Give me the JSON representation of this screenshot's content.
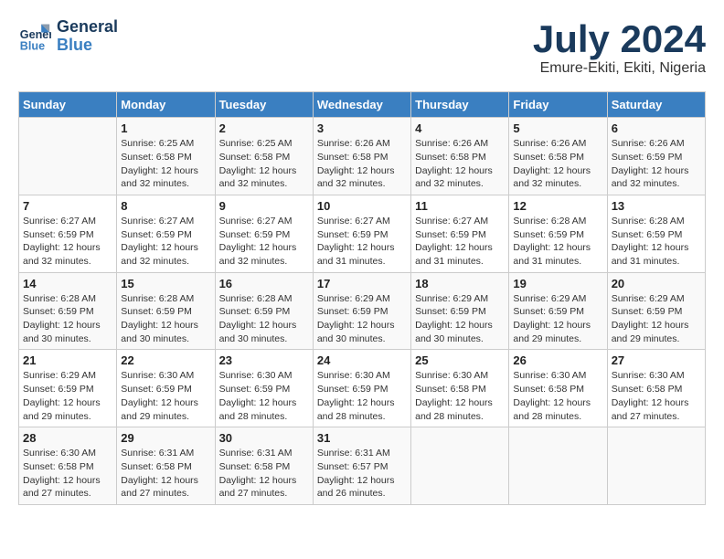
{
  "logo": {
    "line1": "General",
    "line2": "Blue"
  },
  "title": "July 2024",
  "subtitle": "Emure-Ekiti, Ekiti, Nigeria",
  "days_header": [
    "Sunday",
    "Monday",
    "Tuesday",
    "Wednesday",
    "Thursday",
    "Friday",
    "Saturday"
  ],
  "weeks": [
    [
      {
        "num": "",
        "sunrise": "",
        "sunset": "",
        "daylight": ""
      },
      {
        "num": "1",
        "sunrise": "Sunrise: 6:25 AM",
        "sunset": "Sunset: 6:58 PM",
        "daylight": "Daylight: 12 hours and 32 minutes."
      },
      {
        "num": "2",
        "sunrise": "Sunrise: 6:25 AM",
        "sunset": "Sunset: 6:58 PM",
        "daylight": "Daylight: 12 hours and 32 minutes."
      },
      {
        "num": "3",
        "sunrise": "Sunrise: 6:26 AM",
        "sunset": "Sunset: 6:58 PM",
        "daylight": "Daylight: 12 hours and 32 minutes."
      },
      {
        "num": "4",
        "sunrise": "Sunrise: 6:26 AM",
        "sunset": "Sunset: 6:58 PM",
        "daylight": "Daylight: 12 hours and 32 minutes."
      },
      {
        "num": "5",
        "sunrise": "Sunrise: 6:26 AM",
        "sunset": "Sunset: 6:58 PM",
        "daylight": "Daylight: 12 hours and 32 minutes."
      },
      {
        "num": "6",
        "sunrise": "Sunrise: 6:26 AM",
        "sunset": "Sunset: 6:59 PM",
        "daylight": "Daylight: 12 hours and 32 minutes."
      }
    ],
    [
      {
        "num": "7",
        "sunrise": "Sunrise: 6:27 AM",
        "sunset": "Sunset: 6:59 PM",
        "daylight": "Daylight: 12 hours and 32 minutes."
      },
      {
        "num": "8",
        "sunrise": "Sunrise: 6:27 AM",
        "sunset": "Sunset: 6:59 PM",
        "daylight": "Daylight: 12 hours and 32 minutes."
      },
      {
        "num": "9",
        "sunrise": "Sunrise: 6:27 AM",
        "sunset": "Sunset: 6:59 PM",
        "daylight": "Daylight: 12 hours and 32 minutes."
      },
      {
        "num": "10",
        "sunrise": "Sunrise: 6:27 AM",
        "sunset": "Sunset: 6:59 PM",
        "daylight": "Daylight: 12 hours and 31 minutes."
      },
      {
        "num": "11",
        "sunrise": "Sunrise: 6:27 AM",
        "sunset": "Sunset: 6:59 PM",
        "daylight": "Daylight: 12 hours and 31 minutes."
      },
      {
        "num": "12",
        "sunrise": "Sunrise: 6:28 AM",
        "sunset": "Sunset: 6:59 PM",
        "daylight": "Daylight: 12 hours and 31 minutes."
      },
      {
        "num": "13",
        "sunrise": "Sunrise: 6:28 AM",
        "sunset": "Sunset: 6:59 PM",
        "daylight": "Daylight: 12 hours and 31 minutes."
      }
    ],
    [
      {
        "num": "14",
        "sunrise": "Sunrise: 6:28 AM",
        "sunset": "Sunset: 6:59 PM",
        "daylight": "Daylight: 12 hours and 30 minutes."
      },
      {
        "num": "15",
        "sunrise": "Sunrise: 6:28 AM",
        "sunset": "Sunset: 6:59 PM",
        "daylight": "Daylight: 12 hours and 30 minutes."
      },
      {
        "num": "16",
        "sunrise": "Sunrise: 6:28 AM",
        "sunset": "Sunset: 6:59 PM",
        "daylight": "Daylight: 12 hours and 30 minutes."
      },
      {
        "num": "17",
        "sunrise": "Sunrise: 6:29 AM",
        "sunset": "Sunset: 6:59 PM",
        "daylight": "Daylight: 12 hours and 30 minutes."
      },
      {
        "num": "18",
        "sunrise": "Sunrise: 6:29 AM",
        "sunset": "Sunset: 6:59 PM",
        "daylight": "Daylight: 12 hours and 30 minutes."
      },
      {
        "num": "19",
        "sunrise": "Sunrise: 6:29 AM",
        "sunset": "Sunset: 6:59 PM",
        "daylight": "Daylight: 12 hours and 29 minutes."
      },
      {
        "num": "20",
        "sunrise": "Sunrise: 6:29 AM",
        "sunset": "Sunset: 6:59 PM",
        "daylight": "Daylight: 12 hours and 29 minutes."
      }
    ],
    [
      {
        "num": "21",
        "sunrise": "Sunrise: 6:29 AM",
        "sunset": "Sunset: 6:59 PM",
        "daylight": "Daylight: 12 hours and 29 minutes."
      },
      {
        "num": "22",
        "sunrise": "Sunrise: 6:30 AM",
        "sunset": "Sunset: 6:59 PM",
        "daylight": "Daylight: 12 hours and 29 minutes."
      },
      {
        "num": "23",
        "sunrise": "Sunrise: 6:30 AM",
        "sunset": "Sunset: 6:59 PM",
        "daylight": "Daylight: 12 hours and 28 minutes."
      },
      {
        "num": "24",
        "sunrise": "Sunrise: 6:30 AM",
        "sunset": "Sunset: 6:59 PM",
        "daylight": "Daylight: 12 hours and 28 minutes."
      },
      {
        "num": "25",
        "sunrise": "Sunrise: 6:30 AM",
        "sunset": "Sunset: 6:58 PM",
        "daylight": "Daylight: 12 hours and 28 minutes."
      },
      {
        "num": "26",
        "sunrise": "Sunrise: 6:30 AM",
        "sunset": "Sunset: 6:58 PM",
        "daylight": "Daylight: 12 hours and 28 minutes."
      },
      {
        "num": "27",
        "sunrise": "Sunrise: 6:30 AM",
        "sunset": "Sunset: 6:58 PM",
        "daylight": "Daylight: 12 hours and 27 minutes."
      }
    ],
    [
      {
        "num": "28",
        "sunrise": "Sunrise: 6:30 AM",
        "sunset": "Sunset: 6:58 PM",
        "daylight": "Daylight: 12 hours and 27 minutes."
      },
      {
        "num": "29",
        "sunrise": "Sunrise: 6:31 AM",
        "sunset": "Sunset: 6:58 PM",
        "daylight": "Daylight: 12 hours and 27 minutes."
      },
      {
        "num": "30",
        "sunrise": "Sunrise: 6:31 AM",
        "sunset": "Sunset: 6:58 PM",
        "daylight": "Daylight: 12 hours and 27 minutes."
      },
      {
        "num": "31",
        "sunrise": "Sunrise: 6:31 AM",
        "sunset": "Sunset: 6:57 PM",
        "daylight": "Daylight: 12 hours and 26 minutes."
      },
      {
        "num": "",
        "sunrise": "",
        "sunset": "",
        "daylight": ""
      },
      {
        "num": "",
        "sunrise": "",
        "sunset": "",
        "daylight": ""
      },
      {
        "num": "",
        "sunrise": "",
        "sunset": "",
        "daylight": ""
      }
    ]
  ]
}
